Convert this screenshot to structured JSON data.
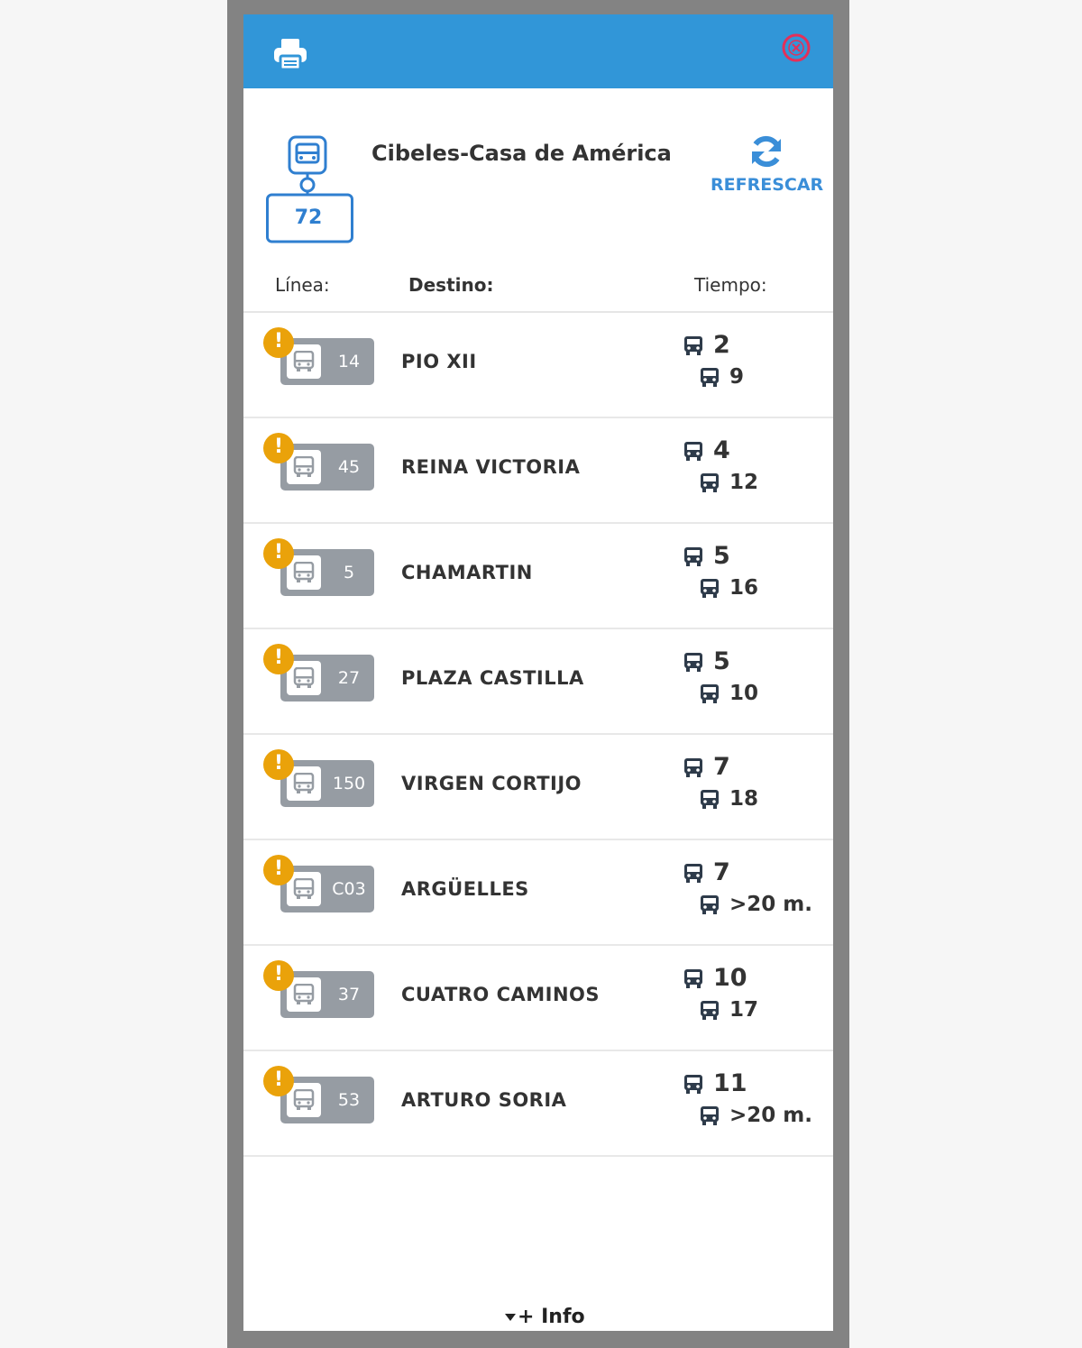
{
  "header": {
    "print_icon": "printer-icon",
    "close_icon": "close-circle-icon",
    "bar_color": "#3196d8",
    "close_color": "#e3305a"
  },
  "stop": {
    "name": "Cibeles-Casa de América",
    "number": "72",
    "icon": "bus-stop-icon",
    "refresh_label": "REFRESCAR",
    "refresh_icon": "refresh-icon"
  },
  "columns": {
    "linea": "Línea:",
    "destino": "Destino:",
    "tiempo": "Tiempo:"
  },
  "arrivals": [
    {
      "line": "14",
      "destination": "PIO XII",
      "next": "2",
      "following": "9"
    },
    {
      "line": "45",
      "destination": "REINA VICTORIA",
      "next": "4",
      "following": "12"
    },
    {
      "line": "5",
      "destination": "CHAMARTIN",
      "next": "5",
      "following": "16"
    },
    {
      "line": "27",
      "destination": "PLAZA CASTILLA",
      "next": "5",
      "following": "10"
    },
    {
      "line": "150",
      "destination": "VIRGEN CORTIJO",
      "next": "7",
      "following": "18"
    },
    {
      "line": "C03",
      "destination": "ARGÜELLES",
      "next": "7",
      "following": ">20 m."
    },
    {
      "line": "37",
      "destination": "CUATRO CAMINOS",
      "next": "10",
      "following": "17"
    },
    {
      "line": "53",
      "destination": "ARTURO SORIA",
      "next": "11",
      "following": ">20 m."
    }
  ],
  "warning_icon": "warning-exclamation-icon",
  "warning_color": "#eaa20a",
  "footer": {
    "info_label": "+ Info",
    "info_icon": "caret-down-icon"
  }
}
